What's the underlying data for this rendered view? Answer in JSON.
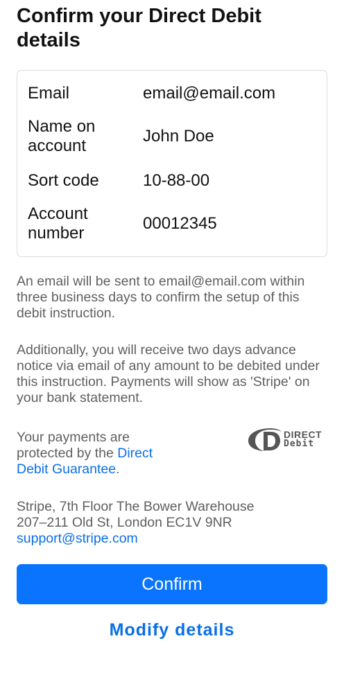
{
  "title": "Confirm your Direct Debit details",
  "details": {
    "rows": [
      {
        "label": "Email",
        "value": "email@email.com"
      },
      {
        "label": "Name on account",
        "value": "John Doe"
      },
      {
        "label": "Sort code",
        "value": "10-88-00"
      },
      {
        "label": "Account number",
        "value": "00012345"
      }
    ]
  },
  "notice": {
    "email_prefix": "An email will be sent to ",
    "email": "email@email.com",
    "email_suffix": " within three business days to confirm the setup of this debit instruction.",
    "advance": "Additionally, you will receive two days advance notice via email of any amount to be debited under this instruction. Payments will show as 'Stripe' on your bank statement.",
    "protected_prefix": "Your payments are protected by the ",
    "guarantee_link": "Direct Debit Guarantee",
    "protected_suffix": "."
  },
  "logo": {
    "icon": "direct-debit-logo-icon",
    "line1": "DIRECT",
    "line2": "Debit",
    "color": "#555555"
  },
  "address": {
    "line1": "Stripe, 7th Floor The Bower Warehouse",
    "line2": "207–211 Old St, London EC1V 9NR",
    "support_email": "support@stripe.com"
  },
  "actions": {
    "confirm_label": "Confirm",
    "modify_label": "Modify details"
  },
  "colors": {
    "accent": "#0a74ff",
    "link": "#0a6fe6",
    "body_text": "#5f5f5f"
  }
}
